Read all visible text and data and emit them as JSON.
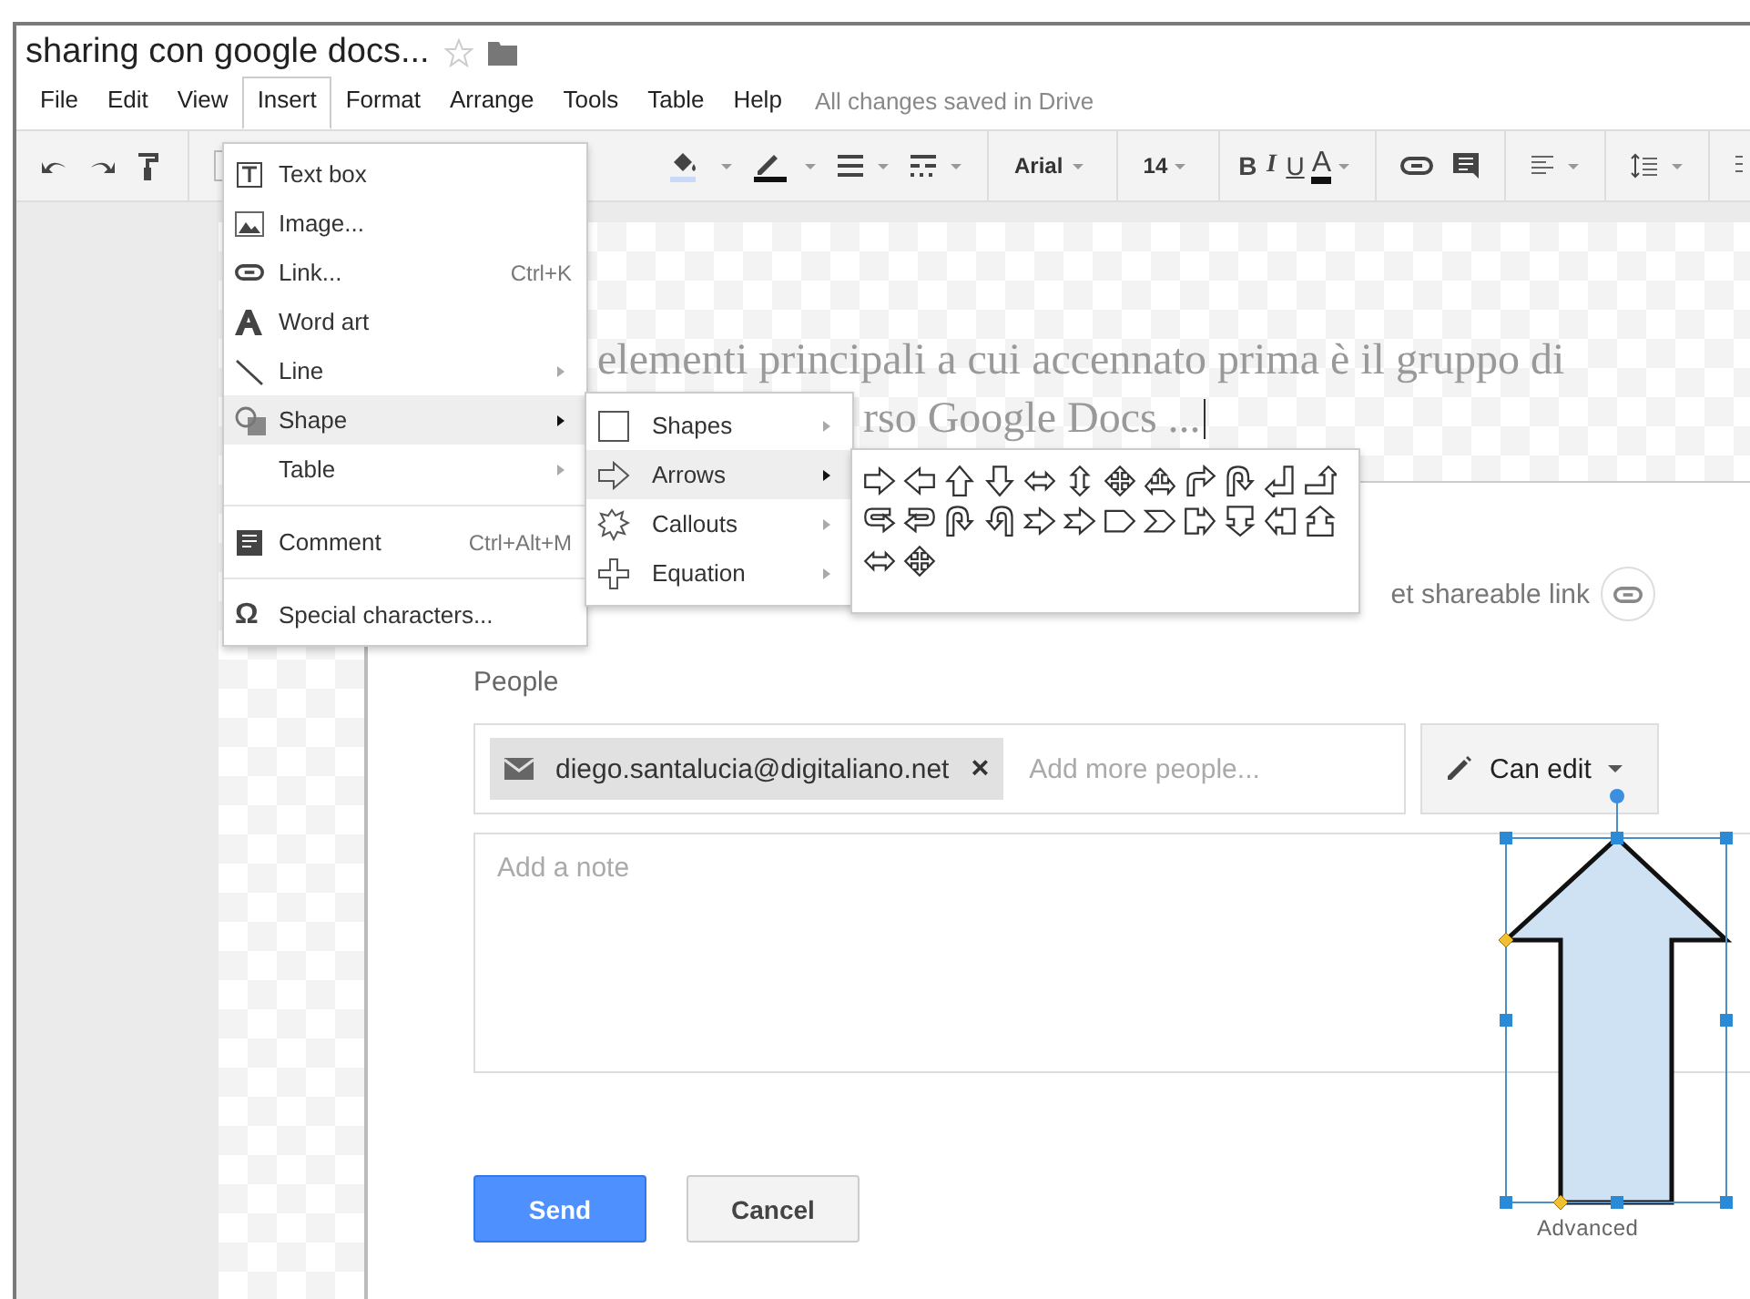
{
  "document": {
    "title": "sharing con google docs...",
    "starred": false
  },
  "menu_bar": [
    {
      "label": "File",
      "selected": false
    },
    {
      "label": "Edit",
      "selected": false
    },
    {
      "label": "View",
      "selected": false
    },
    {
      "label": "Insert",
      "selected": true
    },
    {
      "label": "Format",
      "selected": false
    },
    {
      "label": "Arrange",
      "selected": false
    },
    {
      "label": "Tools",
      "selected": false
    },
    {
      "label": "Table",
      "selected": false
    },
    {
      "label": "Help",
      "selected": false
    }
  ],
  "save_status": "All changes saved in Drive",
  "toolbar": {
    "font": "Arial",
    "font_size": "14",
    "format_buttons": [
      "B",
      "I",
      "U",
      "A"
    ]
  },
  "insert_menu": [
    {
      "kind": "item",
      "label": "Text box",
      "submenu": false,
      "selected": false
    },
    {
      "kind": "item",
      "label": "Image...",
      "submenu": false,
      "selected": false
    },
    {
      "kind": "item",
      "label": "Link...",
      "shortcut": "Ctrl+K",
      "submenu": false,
      "selected": false
    },
    {
      "kind": "item",
      "label": "Word art",
      "submenu": false,
      "selected": false
    },
    {
      "kind": "item",
      "label": "Line",
      "submenu": true,
      "selected": false
    },
    {
      "kind": "item",
      "label": "Shape",
      "submenu": true,
      "selected": true
    },
    {
      "kind": "item",
      "label": "Table",
      "submenu": true,
      "selected": false
    },
    {
      "kind": "separator"
    },
    {
      "kind": "item",
      "label": "Comment",
      "shortcut": "Ctrl+Alt+M",
      "submenu": false,
      "selected": false
    },
    {
      "kind": "separator"
    },
    {
      "kind": "item",
      "label": "Special characters...",
      "symbol": "Ω",
      "submenu": false,
      "selected": false
    }
  ],
  "shape_submenu": [
    {
      "label": "Shapes",
      "selected": false
    },
    {
      "label": "Arrows",
      "selected": true
    },
    {
      "label": "Callouts",
      "selected": false
    },
    {
      "label": "Equation",
      "selected": false
    }
  ],
  "slide": {
    "lines": [
      "elementi principali a cui accennato prima è il gruppo di",
      "rso Google Docs ..."
    ]
  },
  "share_dialog": {
    "link_text": "et shareable link",
    "people_label": "People",
    "chip": {
      "email": "diego.santalucia@digitaliano.net",
      "remove": "×"
    },
    "people_placeholder": "Add more people...",
    "permission": "Can edit",
    "note_placeholder": "Add a note",
    "buttons": [
      "Send",
      "Cancel"
    ],
    "advanced": "Advanced"
  }
}
